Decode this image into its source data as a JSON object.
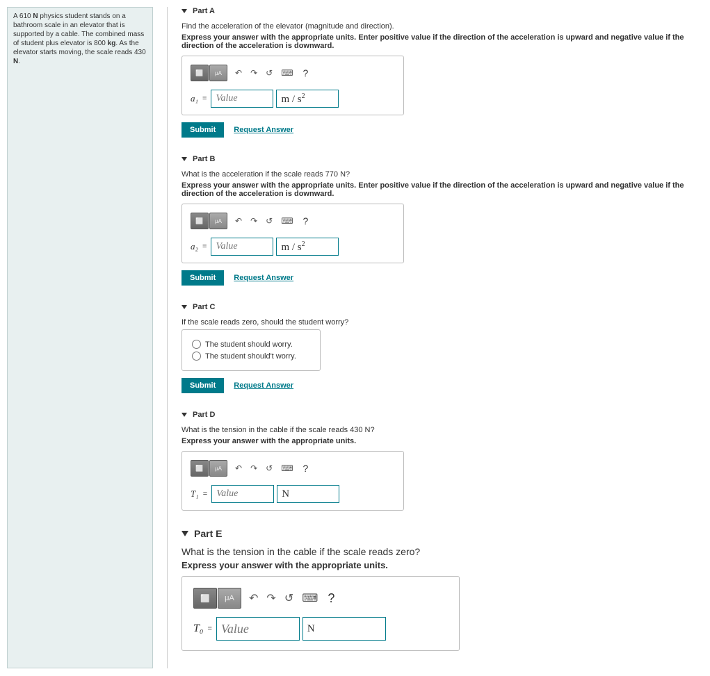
{
  "problem": {
    "text_prefix": "A 610 ",
    "text_weight": "N",
    "text_mid1": " physics student stands on a bathroom scale in an elevator that is supported by a cable. The combined mass of student plus elevator is 800 ",
    "text_unit2": "kg",
    "text_mid2": ". As the elevator starts moving, the scale reads 430 ",
    "text_unit3": "N",
    "text_end": "."
  },
  "common": {
    "submit": "Submit",
    "request": "Request Answer",
    "value_placeholder": "Value",
    "help": "?",
    "eq": "="
  },
  "toolbar": {
    "t1": "⬜",
    "t2": "μA",
    "undo": "↶",
    "redo": "↷",
    "reset": "↺",
    "keyboard": "⌨"
  },
  "partA": {
    "title": "Part A",
    "prompt": "Find the acceleration of the elevator (magnitude and direction).",
    "instr": "Express your answer with the appropriate units. Enter positive value if the direction of the acceleration is upward and negative value if the direction of the acceleration is downward.",
    "var": "a₁",
    "unit_base": "m / s",
    "unit_exp": "2"
  },
  "partB": {
    "title": "Part B",
    "prompt": "What is the acceleration if the scale reads 770 N?",
    "instr": "Express your answer with the appropriate units. Enter positive value if the direction of the acceleration is upward and negative value if the direction of the acceleration is downward.",
    "var": "a₂",
    "unit_base": "m / s",
    "unit_exp": "2"
  },
  "partC": {
    "title": "Part C",
    "prompt": "If the scale reads zero, should the student worry?",
    "opt1": "The student should worry.",
    "opt2": "The student should't worry."
  },
  "partD": {
    "title": "Part D",
    "prompt": "What is the tension in the cable if the scale reads 430 N?",
    "instr": "Express your answer with the appropriate units.",
    "var": "T₁",
    "unit": "N"
  },
  "partE": {
    "title": "Part E",
    "prompt": "What is the tension in the cable if the scale reads zero?",
    "instr": "Express your answer with the appropriate units.",
    "var": "T₀",
    "unit": "N"
  }
}
